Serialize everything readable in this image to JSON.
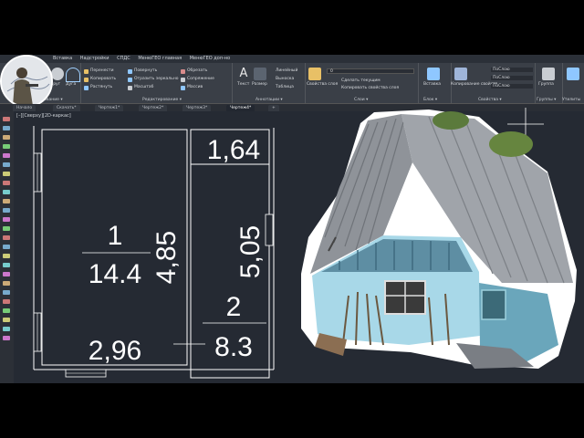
{
  "menubar": {
    "items": [
      "Вставка",
      "Надстройки",
      "СПДС",
      "МенюГЕО главная",
      "МенюГЕО доп-но"
    ]
  },
  "ribbon": {
    "draw_group": {
      "label": "Рисование ▾",
      "line_label": "Отрезок",
      "circle_label": "Круг",
      "arc_label": "Дуга"
    },
    "modify_group": {
      "label": "Редактирование ▾",
      "tools": [
        "Перенести",
        "Повернуть",
        "Обрезать",
        "Копировать",
        "Отразить зеркально",
        "Сопряжение",
        "Растянуть",
        "Масштаб",
        "Массив"
      ]
    },
    "annotation_group": {
      "label": "Аннотации ▾",
      "text_label": "Текст",
      "dim_label": "Размер",
      "tools": [
        "Линейный",
        "Выноска",
        "Таблица"
      ]
    },
    "layers_group": {
      "label": "Слои ▾",
      "props_label": "Свойства слоя",
      "layer_value": "0",
      "tools": [
        "Сделать текущим",
        "Копировать свойства слоя"
      ]
    },
    "block_group": {
      "label": "Блок ▾",
      "insert_label": "Вставка"
    },
    "properties_group": {
      "label": "Свойства ▾",
      "match_label": "Копирование свойств",
      "values": [
        "ПоСлою",
        "ПоСлою",
        "ПоСлою"
      ]
    },
    "groups_group": {
      "label": "Группы ▾",
      "group_label": "Группа"
    },
    "utilities_group": {
      "label": "Утилиты"
    }
  },
  "tabs": [
    "Начало",
    "Скачать*",
    "Чертеж1*",
    "Чертеж2*",
    "Чертеж3*",
    "Чертеж4*"
  ],
  "tab_add": "+",
  "view_label": "[–][Сверху][2D-каркас]",
  "drawing": {
    "room1_number": "1",
    "room1_area": "14.4",
    "room1_height": "4,85",
    "room1_width": "2,96",
    "room2_top": "1,64",
    "room2_height": "5,05",
    "room2_number": "2",
    "room2_area": "8.3"
  },
  "colors": {
    "canvas": "#252a33",
    "ribbon": "#3a3f47",
    "drawing_lines": "#ffffff",
    "sky_wall": "#a8d8e8"
  }
}
